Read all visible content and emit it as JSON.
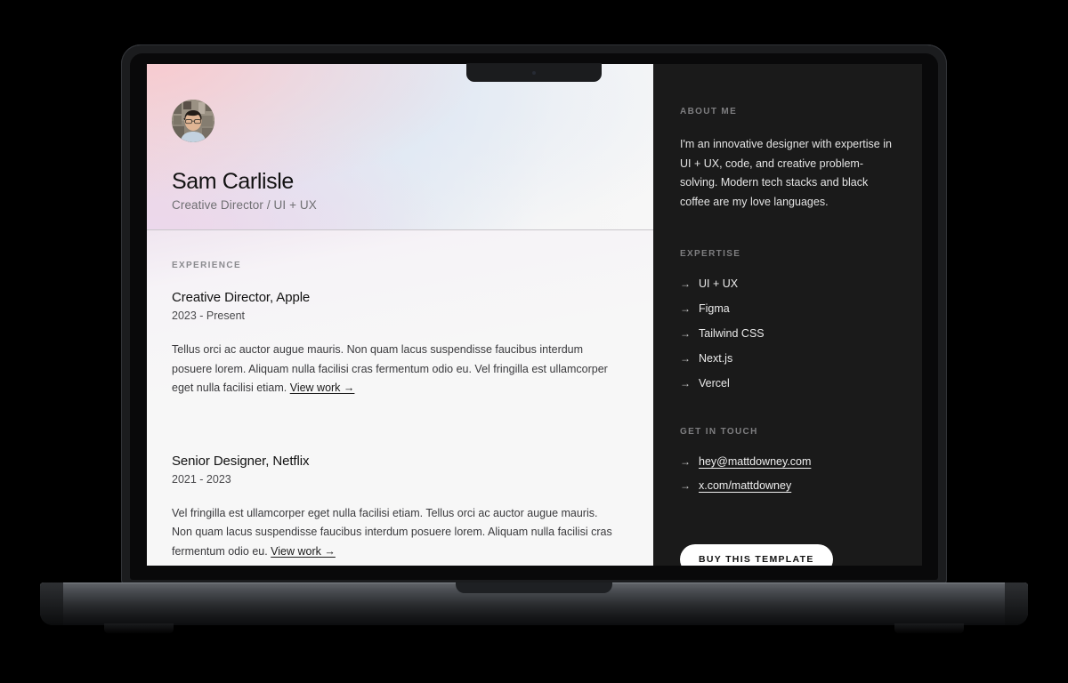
{
  "device": {
    "type": "laptop-mockup",
    "frame_color": "#1b1c1e"
  },
  "profile": {
    "name": "Sam Carlisle",
    "role": "Creative Director / UI + UX",
    "avatar_alt": "portrait-photo"
  },
  "experience": {
    "eyebrow": "EXPERIENCE",
    "jobs": [
      {
        "title": "Creative Director, Apple",
        "dates": "2023 - Present",
        "description": "Tellus orci ac auctor augue mauris. Non quam lacus suspendisse faucibus interdum posuere lorem. Aliquam nulla facilisi cras fermentum odio eu. Vel fringilla est ullamcorper eget nulla facilisi etiam. ",
        "link_label": "View work →"
      },
      {
        "title": "Senior Designer, Netflix",
        "dates": "2021 - 2023",
        "description": "Vel fringilla est ullamcorper eget nulla facilisi etiam. Tellus orci ac auctor augue mauris. Non quam lacus suspendisse faucibus interdum posuere lorem. Aliquam nulla facilisi cras fermentum odio eu. ",
        "link_label": "View work →"
      }
    ]
  },
  "sidebar": {
    "about": {
      "eyebrow": "ABOUT ME",
      "text": "I'm an innovative designer with expertise in UI + UX, code, and creative problem-solving. Modern tech stacks and black coffee are my love languages."
    },
    "expertise": {
      "eyebrow": "EXPERTISE",
      "arrow": "→",
      "items": [
        {
          "label": "UI + UX"
        },
        {
          "label": "Figma"
        },
        {
          "label": "Tailwind CSS"
        },
        {
          "label": "Next.js"
        },
        {
          "label": "Vercel"
        }
      ]
    },
    "contact": {
      "eyebrow": "GET IN TOUCH",
      "arrow": "→",
      "items": [
        {
          "label": "hey@mattdowney.com"
        },
        {
          "label": "x.com/mattdowney"
        }
      ]
    },
    "cta": {
      "label": "BUY THIS TEMPLATE"
    }
  },
  "colors": {
    "sidebar_bg": "#1a1a1a",
    "page_bg": "#f7f7f7",
    "hero_pink": "#f7cbd0",
    "hero_lavender": "#ecd8ec",
    "hero_blue": "#dfe8f4",
    "cta_bg": "#ffffff"
  }
}
